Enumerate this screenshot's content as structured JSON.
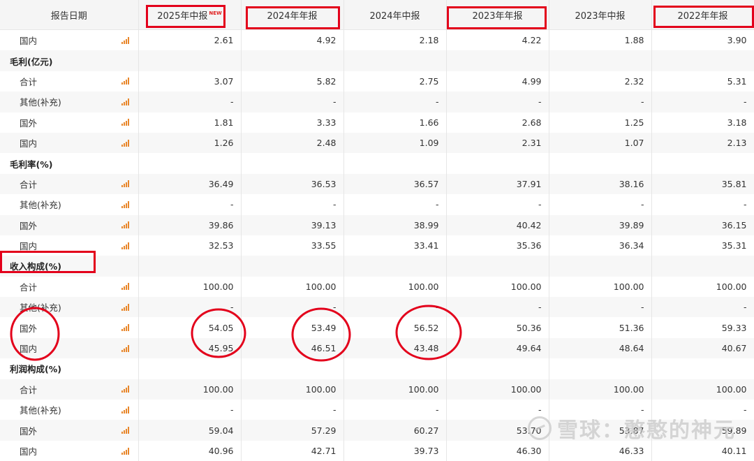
{
  "table": {
    "header": {
      "date_label": "报告日期",
      "columns": [
        "2025年中报",
        "2024年年报",
        "2024年中报",
        "2023年年报",
        "2023年中报",
        "2022年年报"
      ],
      "new_tag": "NEW"
    },
    "rows": [
      {
        "type": "item",
        "label": "国内",
        "values": [
          "2.61",
          "4.92",
          "2.18",
          "4.22",
          "1.88",
          "3.90"
        ]
      },
      {
        "type": "section",
        "label": "毛利(亿元)"
      },
      {
        "type": "item",
        "label": "合计",
        "values": [
          "3.07",
          "5.82",
          "2.75",
          "4.99",
          "2.32",
          "5.31"
        ]
      },
      {
        "type": "item",
        "label": "其他(补充)",
        "values": [
          "-",
          "-",
          "-",
          "-",
          "-",
          "-"
        ]
      },
      {
        "type": "item",
        "label": "国外",
        "values": [
          "1.81",
          "3.33",
          "1.66",
          "2.68",
          "1.25",
          "3.18"
        ]
      },
      {
        "type": "item",
        "label": "国内",
        "values": [
          "1.26",
          "2.48",
          "1.09",
          "2.31",
          "1.07",
          "2.13"
        ]
      },
      {
        "type": "section",
        "label": "毛利率(%)"
      },
      {
        "type": "item",
        "label": "合计",
        "values": [
          "36.49",
          "36.53",
          "36.57",
          "37.91",
          "38.16",
          "35.81"
        ]
      },
      {
        "type": "item",
        "label": "其他(补充)",
        "values": [
          "-",
          "-",
          "-",
          "-",
          "-",
          "-"
        ]
      },
      {
        "type": "item",
        "label": "国外",
        "values": [
          "39.86",
          "39.13",
          "38.99",
          "40.42",
          "39.89",
          "36.15"
        ]
      },
      {
        "type": "item",
        "label": "国内",
        "values": [
          "32.53",
          "33.55",
          "33.41",
          "35.36",
          "36.34",
          "35.31"
        ]
      },
      {
        "type": "section",
        "label": "收入构成(%)"
      },
      {
        "type": "item",
        "label": "合计",
        "values": [
          "100.00",
          "100.00",
          "100.00",
          "100.00",
          "100.00",
          "100.00"
        ]
      },
      {
        "type": "item",
        "label": "其他(补充)",
        "values": [
          "-",
          "-",
          "-",
          "-",
          "-",
          "-"
        ]
      },
      {
        "type": "item",
        "label": "国外",
        "values": [
          "54.05",
          "53.49",
          "56.52",
          "50.36",
          "51.36",
          "59.33"
        ]
      },
      {
        "type": "item",
        "label": "国内",
        "values": [
          "45.95",
          "46.51",
          "43.48",
          "49.64",
          "48.64",
          "40.67"
        ]
      },
      {
        "type": "section",
        "label": "利润构成(%)"
      },
      {
        "type": "item",
        "label": "合计",
        "values": [
          "100.00",
          "100.00",
          "100.00",
          "100.00",
          "100.00",
          "100.00"
        ]
      },
      {
        "type": "item",
        "label": "其他(补充)",
        "values": [
          "-",
          "-",
          "-",
          "-",
          "-",
          "-"
        ]
      },
      {
        "type": "item",
        "label": "国外",
        "values": [
          "59.04",
          "57.29",
          "60.27",
          "53.70",
          "53.87",
          "59.89"
        ]
      },
      {
        "type": "item",
        "label": "国内",
        "values": [
          "40.96",
          "42.71",
          "39.73",
          "46.30",
          "46.33",
          "40.11"
        ]
      }
    ]
  },
  "watermark": {
    "text": "雪球：憨憨的神元"
  },
  "colors": {
    "annotation": "#e3001b",
    "chart_icon": "#e8862a",
    "stripe": "#f7f7f7"
  },
  "icons": {
    "row_chart": "bar-chart-icon",
    "watermark_logo": "snowball-logo-icon"
  }
}
